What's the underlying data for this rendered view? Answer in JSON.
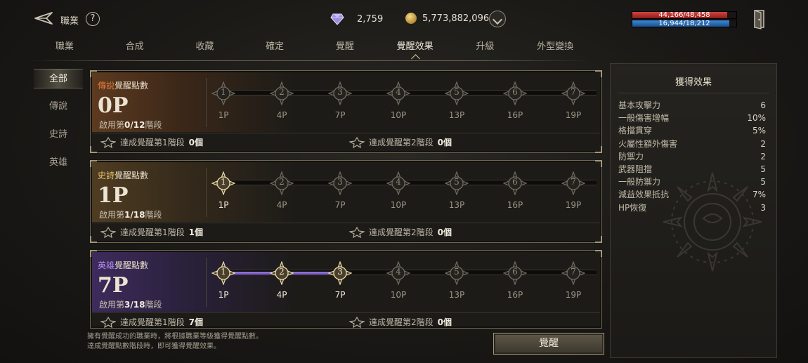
{
  "header": {
    "title": "職業",
    "help_symbol": "?",
    "gems": "2,759",
    "gold": "5,773,882,096",
    "hp_text": "44,166/48,458",
    "hp_fraction": 0.911,
    "mp_text": "16,944/18,212",
    "mp_fraction": 0.93
  },
  "tabs": [
    {
      "label": "職業"
    },
    {
      "label": "合成"
    },
    {
      "label": "收藏"
    },
    {
      "label": "確定"
    },
    {
      "label": "覺醒"
    },
    {
      "label": "覺醒效果",
      "active": true
    },
    {
      "label": "升級"
    },
    {
      "label": "外型變換"
    }
  ],
  "side_filters": [
    {
      "label": "全部",
      "active": true
    },
    {
      "label": "傳說"
    },
    {
      "label": "史詩"
    },
    {
      "label": "英雄"
    }
  ],
  "node_numbers": [
    "1",
    "2",
    "3",
    "4",
    "5",
    "6",
    "7"
  ],
  "node_costs": [
    "1P",
    "4P",
    "7P",
    "10P",
    "13P",
    "16P",
    "19P"
  ],
  "panels": [
    {
      "prefix": "傳說",
      "suffix": "覺醒點數",
      "points": "0",
      "unit": "P",
      "stage_pre": "啟用第",
      "stage": "0/12",
      "stage_post": "階段",
      "active_nodes": 0,
      "filled_segments": 0,
      "reward1_label": "達成覺醒第1階段",
      "reward1_count": "0個",
      "reward2_label": "達成覺醒第2階段",
      "reward2_count": "0個"
    },
    {
      "prefix": "史詩",
      "suffix": "覺醒點數",
      "points": "1",
      "unit": "P",
      "stage_pre": "啟用第",
      "stage": "1/18",
      "stage_post": "階段",
      "active_nodes": 1,
      "filled_segments": 0,
      "reward1_label": "達成覺醒第1階段",
      "reward1_count": "1個",
      "reward2_label": "達成覺醒第2階段",
      "reward2_count": "0個"
    },
    {
      "prefix": "英雄",
      "suffix": "覺醒點數",
      "points": "7",
      "unit": "P",
      "stage_pre": "啟用第",
      "stage": "3/18",
      "stage_post": "階段",
      "active_nodes": 3,
      "filled_segments": 2,
      "reward1_label": "達成覺醒第1階段",
      "reward1_count": "7個",
      "reward2_label": "達成覺醒第2階段",
      "reward2_count": "0個"
    }
  ],
  "note": {
    "line1": "擁有覺醒成功的職業時，將根據職業等級獲得覺醒點數。",
    "line2": "達成覺醒點數階段時，即可獲得覺醒效果。"
  },
  "awaken_button": "覺醒",
  "effects": {
    "title": "獲得效果",
    "rows": [
      {
        "name": "基本攻擊力",
        "value": "6"
      },
      {
        "name": "一般傷害增幅",
        "value": "10%"
      },
      {
        "name": "格擋貫穿",
        "value": "5%"
      },
      {
        "name": "火屬性額外傷害",
        "value": "2"
      },
      {
        "name": "防禦力",
        "value": "2"
      },
      {
        "name": "武器阻擋",
        "value": "5"
      },
      {
        "name": "一般防禦力",
        "value": "5"
      },
      {
        "name": "減益效果抵抗",
        "value": "7%"
      },
      {
        "name": "HP恢復",
        "value": "3"
      }
    ]
  },
  "colors": {
    "legend": "#e07b3a",
    "epic": "#e8c36a",
    "hero": "#b78cf0",
    "hp": "#d2443e",
    "mp": "#3c8ad8"
  }
}
